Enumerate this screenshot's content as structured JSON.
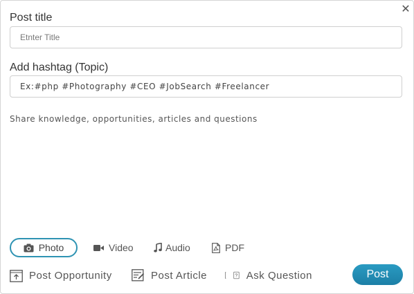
{
  "close_icon": "close-icon",
  "title": {
    "label": "Post title",
    "placeholder": "Etnter Title"
  },
  "hashtag": {
    "label": "Add hashtag (Topic)",
    "placeholder": "Ex:#php #Photography #CEO #JobSearch #Freelancer"
  },
  "share": {
    "placeholder": "Share knowledge, opportunities, articles and questions"
  },
  "media": [
    {
      "label": "Photo",
      "icon": "camera-icon"
    },
    {
      "label": "Video",
      "icon": "video-camera-icon"
    },
    {
      "label": "Audio",
      "icon": "music-note-icon"
    },
    {
      "label": "PDF",
      "icon": "pdf-file-icon"
    }
  ],
  "actions": [
    {
      "label": "Post Opportunity",
      "icon": "upload-opportunity-icon"
    },
    {
      "label": "Post Article",
      "icon": "article-icon"
    },
    {
      "label": "Ask Question",
      "icon": "question-icon"
    }
  ],
  "post_button": "Post",
  "colors": {
    "accent": "#2e93b3",
    "button": "#2489b0"
  }
}
